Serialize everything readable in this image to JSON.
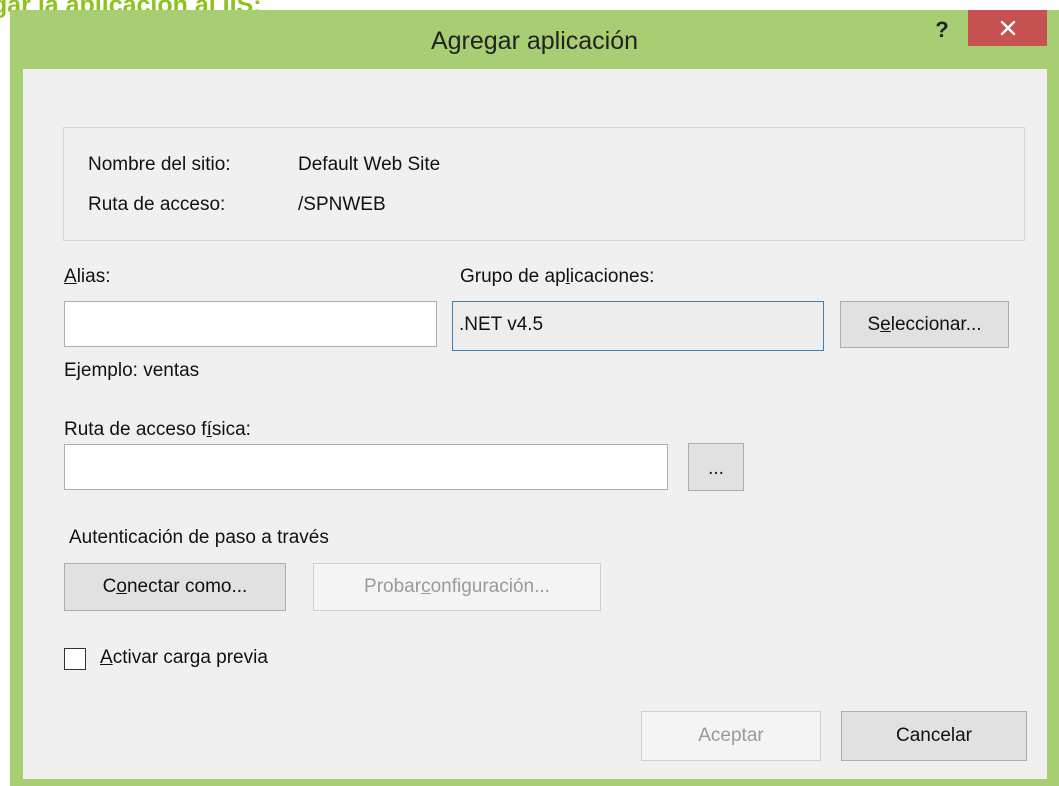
{
  "background_caption": "gar la aplicación al IIS:",
  "dialog": {
    "title": "Agregar aplicación",
    "help_symbol": "?",
    "close_symbol": "✕"
  },
  "site_info": {
    "site_name_label": "Nombre del sitio:",
    "site_name_value": "Default Web Site",
    "path_label": "Ruta de acceso:",
    "path_value": "/SPNWEB"
  },
  "alias": {
    "label_prefix": "",
    "label_accel": "A",
    "label_rest": "lias:",
    "value": "",
    "example": "Ejemplo: ventas"
  },
  "app_pool": {
    "label_prefix": "Grupo de ap",
    "label_accel": "l",
    "label_rest": "icaciones:",
    "value": ".NET v4.5",
    "select_prefix": "S",
    "select_accel": "e",
    "select_rest": "leccionar..."
  },
  "physical_path": {
    "label_prefix": "Ruta de acceso f",
    "label_accel": "í",
    "label_rest": "sica:",
    "value": "",
    "browse_label": "..."
  },
  "auth": {
    "heading": "Autenticación de paso a través",
    "connect_prefix": "C",
    "connect_accel": "o",
    "connect_rest": "nectar como...",
    "test_prefix": "Probar ",
    "test_accel": "c",
    "test_rest": "onfiguración..."
  },
  "preload": {
    "label_prefix": "",
    "label_accel": "A",
    "label_rest": "ctivar carga previa",
    "checked": false
  },
  "footer": {
    "ok_label": "Aceptar",
    "cancel_label": "Cancelar"
  },
  "colors": {
    "accent_green": "#8dc21f",
    "window_border": "#a8ce73",
    "close_red": "#c75050",
    "focus_blue": "#3c7fb1"
  }
}
